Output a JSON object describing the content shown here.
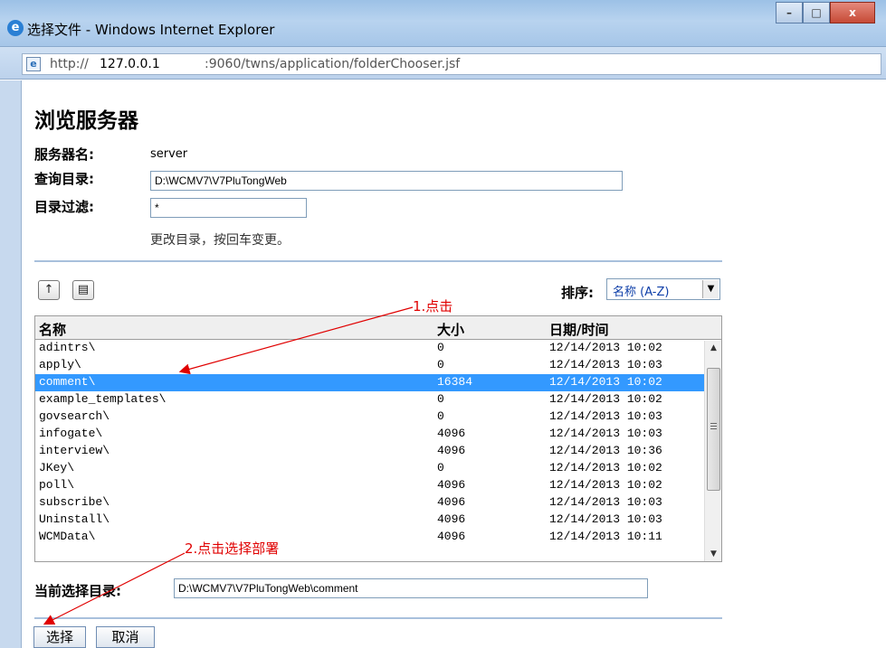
{
  "window": {
    "title": "选择文件 - Windows Internet Explorer",
    "minimize": "–",
    "maximize": "□",
    "close": "x",
    "address_prefix": "http://",
    "address_host": "127.0.0.1",
    "address_path": ":9060/twns/application/folderChooser.jsf"
  },
  "page": {
    "heading": "浏览服务器",
    "server_label": "服务器名:",
    "server_value": "server",
    "directory_label": "查询目录:",
    "directory_value": "D:\\WCMV7\\V7PluTongWeb",
    "filter_label": "目录过滤:",
    "filter_value": "*",
    "hint": "更改目录，按回车变更。"
  },
  "toolbar": {
    "up_glyph": "↑",
    "newfolder_glyph": "▤",
    "sort_label": "排序:",
    "sort_value": "名称 (A-Z)"
  },
  "list": {
    "headers": {
      "name": "名称",
      "size": "大小",
      "date": "日期/时间"
    },
    "rows": [
      {
        "name": "adintrs\\",
        "size": "0",
        "date": "12/14/2013 10:02",
        "selected": false
      },
      {
        "name": "apply\\",
        "size": "0",
        "date": "12/14/2013 10:03",
        "selected": false
      },
      {
        "name": "comment\\",
        "size": "16384",
        "date": "12/14/2013 10:02",
        "selected": true
      },
      {
        "name": "example_templates\\",
        "size": "0",
        "date": "12/14/2013 10:02",
        "selected": false
      },
      {
        "name": "govsearch\\",
        "size": "0",
        "date": "12/14/2013 10:03",
        "selected": false
      },
      {
        "name": "infogate\\",
        "size": "4096",
        "date": "12/14/2013 10:03",
        "selected": false
      },
      {
        "name": "interview\\",
        "size": "4096",
        "date": "12/14/2013 10:36",
        "selected": false
      },
      {
        "name": "JKey\\",
        "size": "0",
        "date": "12/14/2013 10:02",
        "selected": false
      },
      {
        "name": "poll\\",
        "size": "4096",
        "date": "12/14/2013 10:02",
        "selected": false
      },
      {
        "name": "subscribe\\",
        "size": "4096",
        "date": "12/14/2013 10:03",
        "selected": false
      },
      {
        "name": "Uninstall\\",
        "size": "4096",
        "date": "12/14/2013 10:03",
        "selected": false
      },
      {
        "name": "WCMData\\",
        "size": "4096",
        "date": "12/14/2013 10:11",
        "selected": false
      },
      {
        "name": "",
        "size": "",
        "date": "",
        "selected": false
      }
    ]
  },
  "current": {
    "label": "当前选择目录:",
    "value": "D:\\WCMV7\\V7PluTongWeb\\comment"
  },
  "annotations": {
    "step1": "1.点击",
    "step2": "2.点击选择部署",
    "color": "#e00000"
  },
  "buttons": {
    "select": "选择",
    "cancel": "取消"
  }
}
